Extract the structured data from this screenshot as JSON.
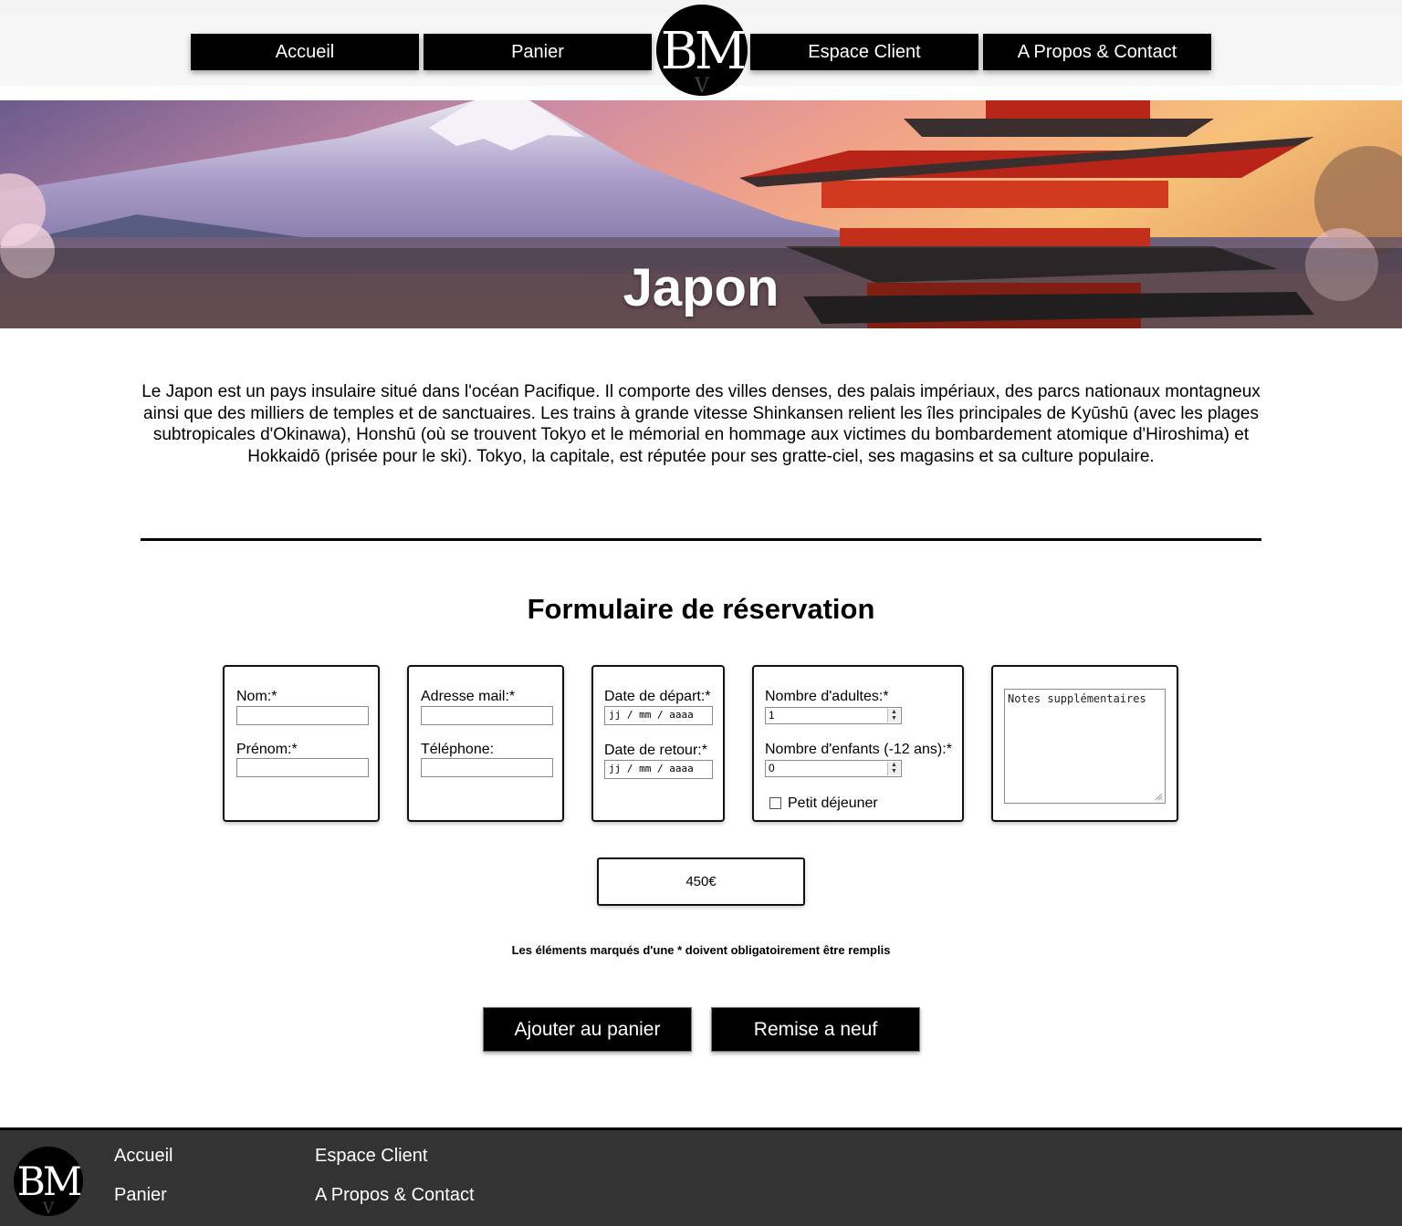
{
  "nav": {
    "home": "Accueil",
    "cart": "Panier",
    "client_area": "Espace Client",
    "about": "A Propos & Contact",
    "logo_text": "BM"
  },
  "hero": {
    "title": "Japon"
  },
  "description": "Le Japon est un pays insulaire situé dans l'océan Pacifique. Il comporte des villes denses, des palais impériaux, des parcs nationaux montagneux ainsi que des milliers de temples et de sanctuaires. Les trains à grande vitesse Shinkansen relient les îles principales de Kyūshū (avec les plages subtropicales d'Okinawa), Honshū (où se trouvent Tokyo et le mémorial en hommage aux victimes du bombardement atomique d'Hiroshima) et Hokkaidō (prisée pour le ski). Tokyo, la capitale, est réputée pour ses gratte-ciel, ses magasins et sa culture populaire.",
  "form": {
    "title": "Formulaire de réservation",
    "name_label": "Nom:*",
    "firstname_label": "Prénom:*",
    "email_label": "Adresse mail:*",
    "phone_label": "Téléphone:",
    "departure_label": "Date de départ:*",
    "return_label": "Date de retour:*",
    "date_placeholder": "jj / mm / aaaa",
    "adults_label": "Nombre d'adultes:*",
    "adults_value": "1",
    "children_label": "Nombre d'enfants (-12 ans):*",
    "children_value": "0",
    "breakfast_label": "Petit déjeuner",
    "breakfast_checked": false,
    "notes_placeholder": "Notes supplémentaires",
    "price": "450€",
    "required_note": "Les éléments marqués d'une * doivent obligatoirement être remplis",
    "add_to_cart": "Ajouter au panier",
    "reset": "Remise a neuf"
  },
  "footer": {
    "home": "Accueil",
    "cart": "Panier",
    "client_area": "Espace Client",
    "about": "A Propos & Contact"
  },
  "colors": {
    "nav_bg": "#000000",
    "footer_bg": "#333333",
    "header_bg": "#f6f6f6"
  }
}
